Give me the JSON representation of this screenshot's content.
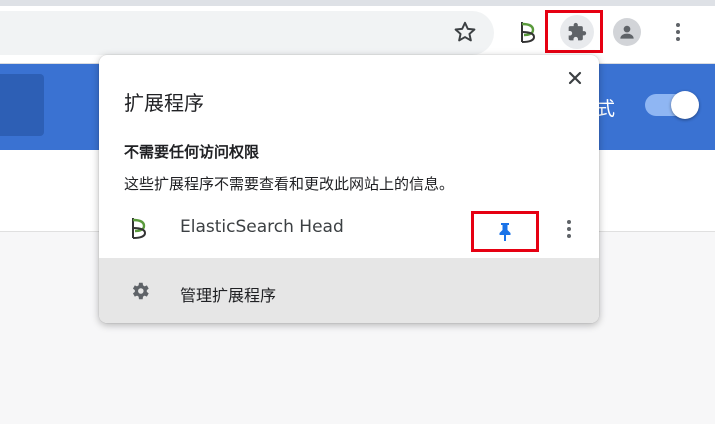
{
  "popup": {
    "title": "扩展程序",
    "section_title": "不需要任何访问权限",
    "section_description": "这些扩展程序不需要查看和更改此网站上的信息。",
    "extensions": [
      {
        "name": "ElasticSearch Head",
        "icon": "elasticsearch-head-icon",
        "pinned": true
      }
    ],
    "manage_label": "管理扩展程序"
  },
  "page": {
    "banner_text": "式"
  },
  "colors": {
    "accent_blue": "#1a73e8",
    "banner_blue": "#3a72d2",
    "highlight_red": "#e60012"
  }
}
